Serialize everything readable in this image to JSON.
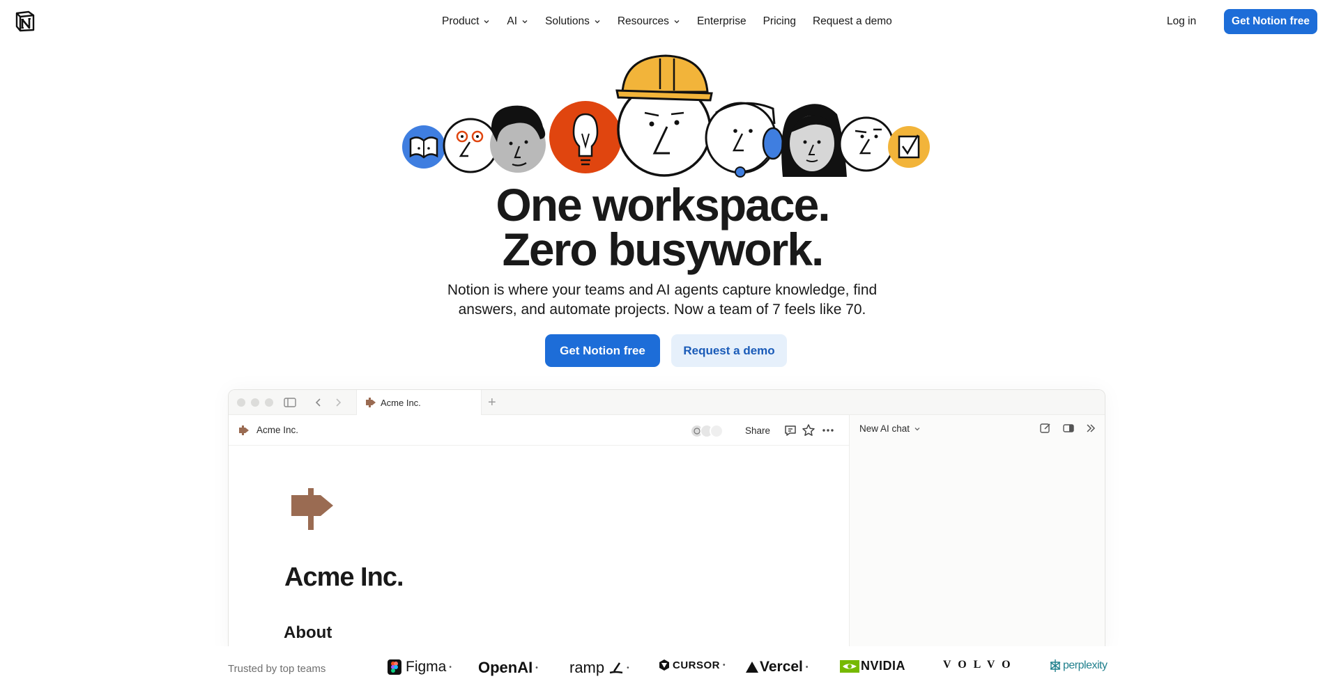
{
  "nav": {
    "logo": "notion-logo",
    "links": [
      "Product",
      "AI",
      "Solutions",
      "Resources",
      "Enterprise",
      "Pricing",
      "Request a demo"
    ],
    "login": "Log in",
    "cta": "Get Notion free"
  },
  "hero": {
    "headline_1": "One workspace.",
    "headline_2": "Zero busywork.",
    "subtitle_1": "Notion is where your teams and AI agents capture knowledge, find",
    "subtitle_2": "answers, and automate projects. Now a team of 7 feels like 70.",
    "primary_cta": "Get Notion free",
    "secondary_cta": "Request a demo"
  },
  "app": {
    "tab_label": "Acme Inc.",
    "page_breadcrumb": "Acme Inc.",
    "share": "Share",
    "page_title": "Acme Inc.",
    "section_heading": "About",
    "ai_panel_title": "New AI chat"
  },
  "trusted": {
    "label": "Trusted by top teams",
    "brands": [
      "Figma",
      "OpenAI",
      "ramp",
      "CURSOR",
      "Vercel",
      "NVIDIA",
      "VOLVO",
      "perplexity"
    ]
  },
  "colors": {
    "primary_blue": "#1d6dd8",
    "secondary_bg": "#e6f0fb",
    "sign_brown": "#9a6b52",
    "orange": "#e0450f",
    "yellow": "#f2b43a",
    "book_blue": "#3f7ee0"
  }
}
